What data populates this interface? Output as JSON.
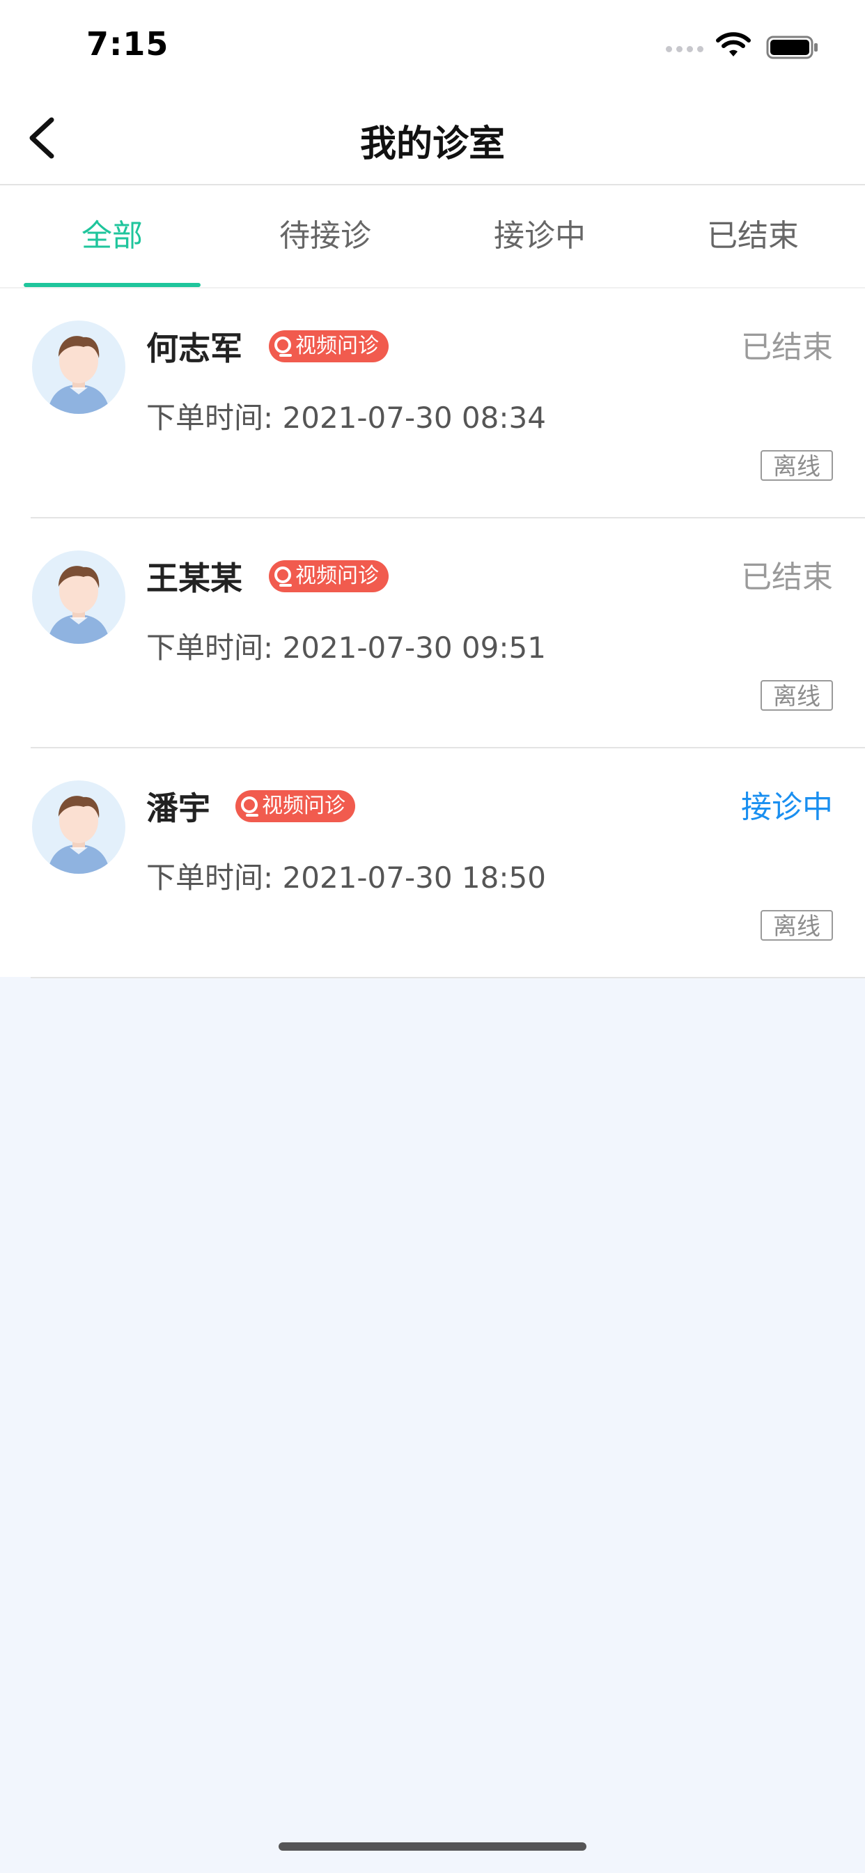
{
  "status_bar": {
    "time": "7:15"
  },
  "nav": {
    "title": "我的诊室",
    "back_icon": "chevron-left-icon"
  },
  "tabs": [
    {
      "label": "全部",
      "active": true
    },
    {
      "label": "待接诊",
      "active": false
    },
    {
      "label": "接诊中",
      "active": false
    },
    {
      "label": "已结束",
      "active": false
    }
  ],
  "consultations": [
    {
      "name": "何志军",
      "badge": "视频问诊",
      "status": "已结束",
      "time": "下单时间: 2021-07-30 08:34",
      "tag": "离线"
    },
    {
      "name": "王某某",
      "badge": "视频问诊",
      "status": "已结束",
      "time": "下单时间: 2021-07-30 09:51",
      "tag": "离线"
    },
    {
      "name": "潘宇",
      "badge": "视频问诊",
      "status": "接诊中",
      "time": "下单时间: 2021-07-30 18:50",
      "tag": "离线"
    }
  ],
  "colors": {
    "accent": "#1fc59c",
    "badge": "#f15b4e",
    "active_status": "#1a8ff0",
    "page_bg": "#f2f6fd"
  }
}
